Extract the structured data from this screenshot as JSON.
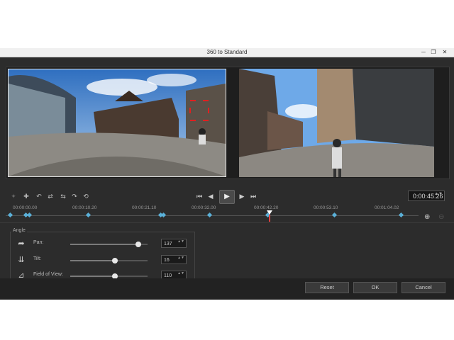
{
  "window": {
    "title": "360 to Standard",
    "minimize": "─",
    "restore": "❐",
    "close": "✕"
  },
  "toolbar": {
    "tools": [
      "✦",
      "✚",
      "↶",
      "⇄",
      "⇆",
      "↷",
      "⟲"
    ],
    "transport": {
      "first": "⏮",
      "prev": "◀",
      "play": "▶",
      "next": "▶",
      "last": "⏭"
    },
    "timecode": "0:00:45.26",
    "timecode_spin": "▲▼"
  },
  "timeline": {
    "ticks": [
      "00:00:00.00",
      "00:00:10.20",
      "00:00:21.10",
      "00:00:32.00",
      "00:00:42.20",
      "00:00:53.10",
      "00:01:04.02"
    ],
    "zoom_in": "⊕",
    "zoom_out": "⊖"
  },
  "angle": {
    "label": "Angle",
    "params": [
      {
        "label": "Pan:",
        "value": "137",
        "level_percent": 88,
        "icon": "pan-icon",
        "glyph": "➦",
        "spin": "▲▼"
      },
      {
        "label": "Tilt:",
        "value": "16",
        "level_percent": 58,
        "icon": "tilt-icon",
        "glyph": "⇊",
        "spin": "▲▼"
      },
      {
        "label": "Field of View:",
        "value": "110",
        "level_percent": 58,
        "icon": "fov-icon",
        "glyph": "⊿",
        "spin": "▲▼"
      }
    ]
  },
  "buttons": {
    "reset": "Reset",
    "ok": "OK",
    "cancel": "Cancel"
  },
  "colors": {
    "keyframe": "#5ab0d8",
    "playhead": "#e04040",
    "selection": "#e02020"
  }
}
